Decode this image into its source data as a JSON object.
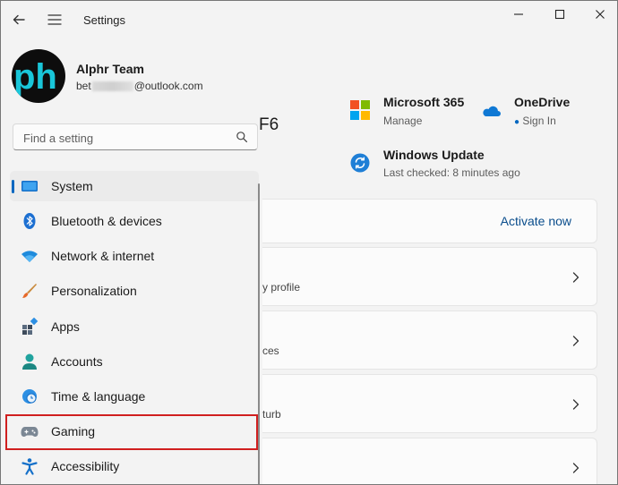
{
  "window": {
    "title": "Settings",
    "controls": {
      "minimize": "—",
      "maximize": "☐",
      "close": "✕"
    }
  },
  "user": {
    "avatar_text": "ph",
    "name": "Alphr Team",
    "email_prefix": "bet",
    "email_domain": "@outlook.com"
  },
  "search": {
    "placeholder": "Find a setting",
    "value": ""
  },
  "nav": {
    "items": [
      {
        "label": "System",
        "icon": "system-icon",
        "selected": true
      },
      {
        "label": "Bluetooth & devices",
        "icon": "bluetooth-icon"
      },
      {
        "label": "Network & internet",
        "icon": "wifi-icon"
      },
      {
        "label": "Personalization",
        "icon": "brush-icon"
      },
      {
        "label": "Apps",
        "icon": "apps-icon"
      },
      {
        "label": "Accounts",
        "icon": "person-icon"
      },
      {
        "label": "Time & language",
        "icon": "globe-clock-icon"
      },
      {
        "label": "Gaming",
        "icon": "controller-icon",
        "highlighted": true
      },
      {
        "label": "Accessibility",
        "icon": "accessibility-icon"
      }
    ]
  },
  "main": {
    "device_name_fragment": "F6",
    "tiles": {
      "m365": {
        "title": "Microsoft 365",
        "sub": "Manage"
      },
      "onedrive": {
        "title": "OneDrive",
        "sub": "Sign In"
      },
      "update": {
        "title": "Windows Update",
        "sub": "Last checked: 8 minutes ago"
      }
    },
    "activate_label": "Activate now",
    "card_fragments": [
      "y profile",
      "ces",
      "turb"
    ]
  },
  "colors": {
    "accent": "#0067c0",
    "highlight_border": "#d01f1f",
    "link": "#0a4d8c",
    "sidebar_bg": "#f3f3f3"
  }
}
